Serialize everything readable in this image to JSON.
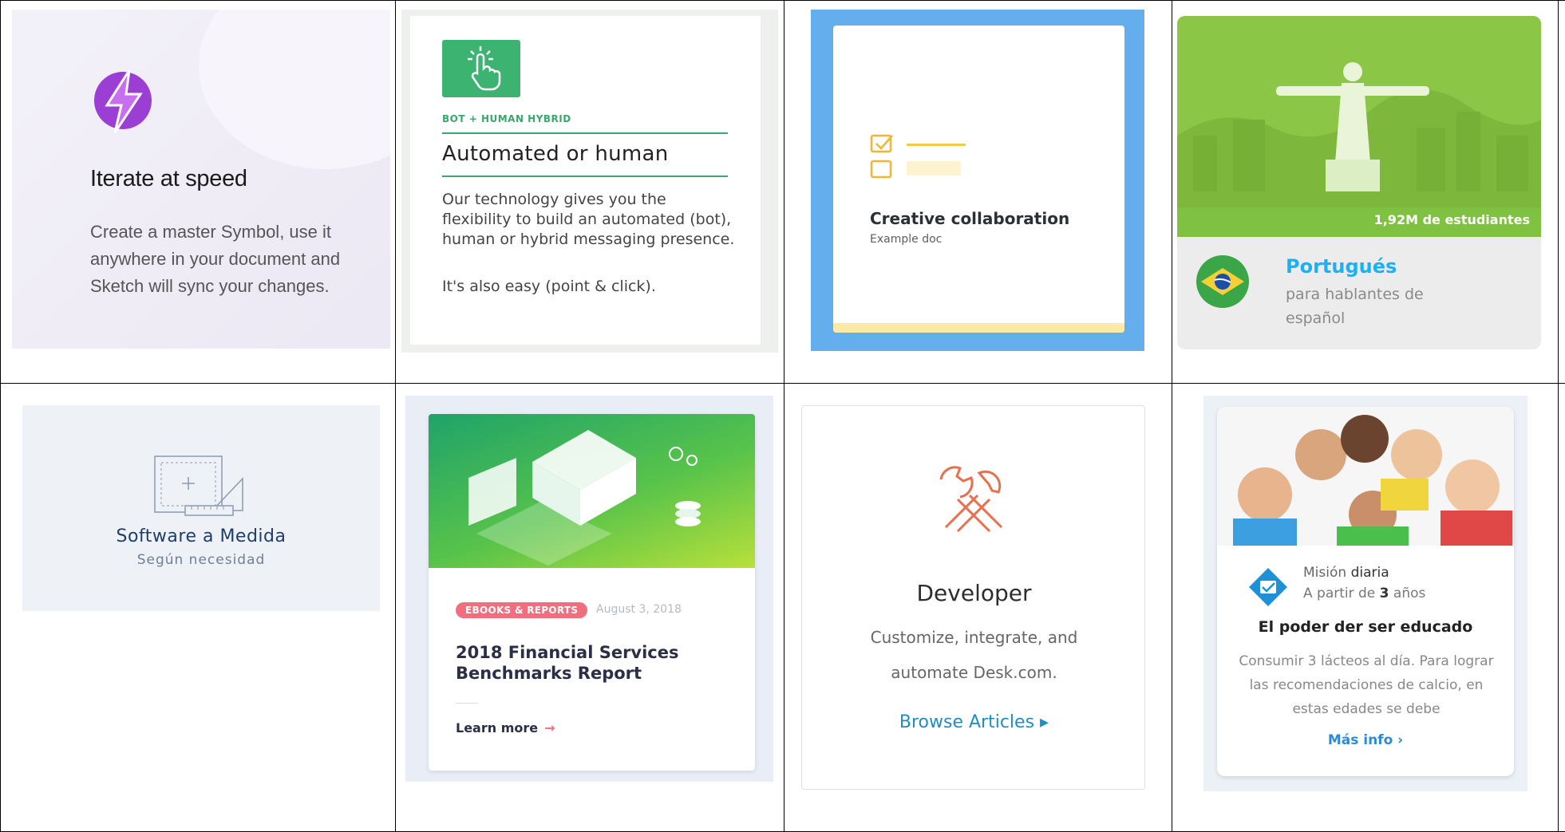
{
  "cards": {
    "iterate": {
      "title": "Iterate at speed",
      "body": "Create a master Symbol, use it anywhere in your document and Sketch will sync your changes.",
      "icon": "bolt-icon",
      "accent": "#9b3fd4"
    },
    "automated": {
      "tag": "BOT + HUMAN HYBRID",
      "title": "Automated or human",
      "body": "Our technology gives you the flexibility to build an automated (bot), human or hybrid messaging presence.",
      "body2": "It's also easy (point & click).",
      "icon": "tap-icon",
      "accent": "#3aa76d"
    },
    "creative": {
      "title": "Creative collaboration",
      "subtitle": "Example doc",
      "icon": "checklist-icon",
      "accent": "#64aeee"
    },
    "portugues": {
      "count": "1,92M de estudiantes",
      "language": "Portugués",
      "subtitle": "para hablantes de español",
      "icon": "brazil-flag-icon",
      "accent": "#1cb0f6"
    },
    "software": {
      "title": "Software a Medida",
      "subtitle": "Según necesidad",
      "icon": "blueprint-ruler-icon"
    },
    "financial": {
      "badge": "EBOOKS & REPORTS",
      "date": "August 3, 2018",
      "title": "2018 Financial Services Benchmarks Report",
      "link": "Learn more",
      "arrow": "→",
      "accent": "#f26d7d"
    },
    "developer": {
      "title": "Developer",
      "line1": "Customize, integrate, and",
      "line2": "automate Desk.com.",
      "link": "Browse Articles ▸",
      "icon": "wrench-tools-icon",
      "accent": "#e8704e"
    },
    "mision": {
      "line1_a": "Misión",
      "line1_b": "diaria",
      "line2_a": "A partir de",
      "line2_b": "3",
      "line2_c": "años",
      "title": "El poder der ser educado",
      "body": "Consumir 3 lácteos al día. Para lograr las recomendaciones de calcio, en estas edades se debe",
      "link": "Más info ›",
      "icon": "mision-logo-icon"
    }
  }
}
